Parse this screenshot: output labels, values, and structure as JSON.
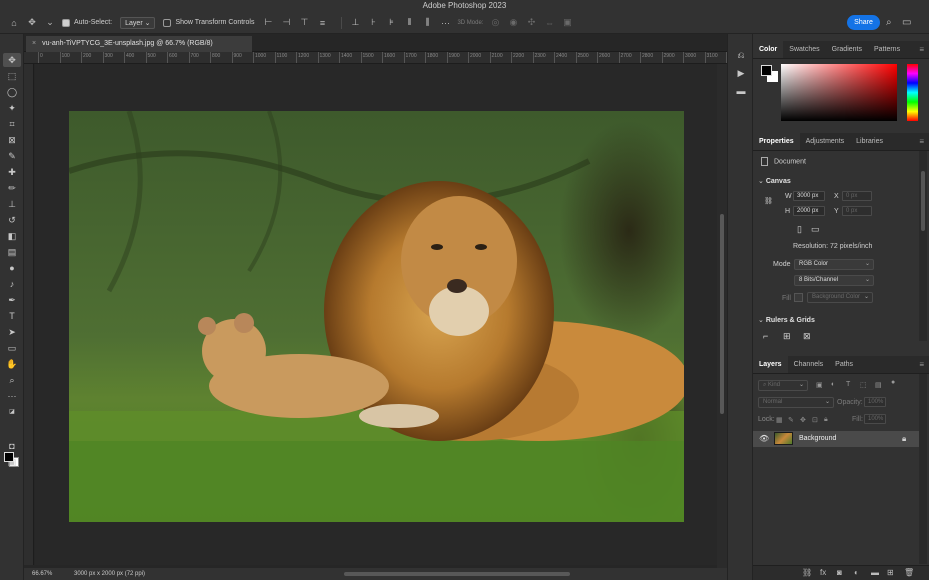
{
  "app": {
    "title": "Adobe Photoshop 2023"
  },
  "options": {
    "auto_select_label": "Auto-Select:",
    "auto_select_value": "Layer",
    "transform_controls_label": "Show Transform Controls",
    "mode_3d_label": "3D Mode:",
    "more_label": "···",
    "share_label": "Share"
  },
  "document": {
    "tab_title": "vu-anh-TiVPTYCG_3E-unsplash.jpg @ 66.7% (RGB/8)",
    "close_glyph": "×"
  },
  "ruler": {
    "ticks": [
      "0",
      "100",
      "200",
      "300",
      "400",
      "500",
      "600",
      "700",
      "800",
      "900",
      "1000",
      "1100",
      "1200",
      "1300",
      "1400",
      "1500",
      "1600",
      "1700",
      "1800",
      "1900",
      "2000",
      "2100",
      "2200",
      "2300",
      "2400",
      "2500",
      "2600",
      "2700",
      "2800",
      "2900",
      "3000",
      "3100",
      "3200"
    ]
  },
  "status": {
    "zoom": "66.67%",
    "doc_info": "3000 px x 2000 px (72 ppi)"
  },
  "color_panel": {
    "tabs": [
      "Color",
      "Swatches",
      "Gradients",
      "Patterns"
    ],
    "active_tab": "Color",
    "fg": "#000000",
    "bg": "#ffffff"
  },
  "properties_panel": {
    "tabs": [
      "Properties",
      "Adjustments",
      "Libraries"
    ],
    "active_tab": "Properties",
    "doc_label": "Document",
    "canvas_section": "Canvas",
    "w_label": "W",
    "w_value": "3000 px",
    "h_label": "H",
    "h_value": "2000 px",
    "x_label": "X",
    "x_value": "0 px",
    "y_label": "Y",
    "y_value": "0 px",
    "resolution": "Resolution: 72 pixels/inch",
    "mode_label": "Mode",
    "mode_value": "RGB Color",
    "depth_value": "8 Bits/Channel",
    "fill_label": "Fill",
    "fill_value": "Background Color",
    "rulers_section": "Rulers & Grids"
  },
  "layers_panel": {
    "tabs": [
      "Layers",
      "Channels",
      "Paths"
    ],
    "active_tab": "Layers",
    "kind_label": "Kind",
    "blend_mode": "Normal",
    "opacity_label": "Opacity:",
    "opacity_value": "100%",
    "lock_label": "Lock:",
    "fill_label": "Fill:",
    "fill_value": "100%",
    "layers": [
      {
        "name": "Background",
        "visible": true,
        "locked": true
      }
    ]
  },
  "colors": {
    "accent": "#1473e6",
    "panel_bg": "#323232",
    "app_bg": "#262626"
  }
}
